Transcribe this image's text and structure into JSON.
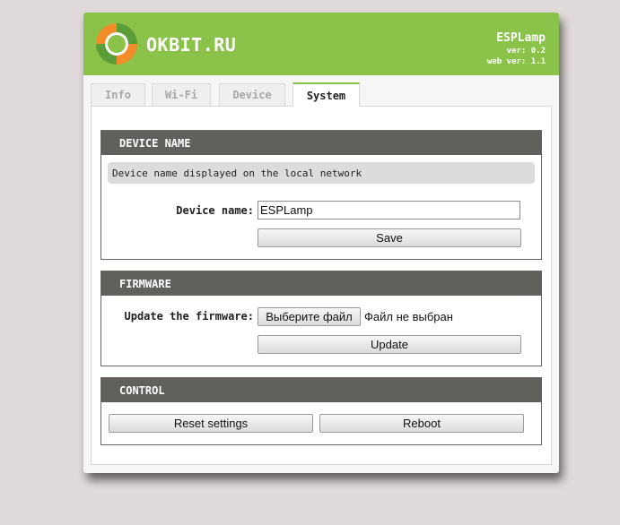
{
  "header": {
    "brand": "OKBIT.RU",
    "app_name": "ESPLamp",
    "version": "ver: 0.2",
    "web_version": "web ver: 1.1"
  },
  "tabs": [
    {
      "label": "Info",
      "active": false
    },
    {
      "label": "Wi-Fi",
      "active": false
    },
    {
      "label": "Device",
      "active": false
    },
    {
      "label": "System",
      "active": true
    }
  ],
  "device_name": {
    "title": "DEVICE NAME",
    "hint": "Device name displayed on the local network",
    "field_label": "Device name:",
    "field_value": "ESPLamp",
    "save_label": "Save"
  },
  "firmware": {
    "title": "FIRMWARE",
    "field_label": "Update the firmware:",
    "choose_file_label": "Выберите файл",
    "file_status": "Файл не выбран",
    "update_label": "Update"
  },
  "control": {
    "title": "CONTROL",
    "reset_label": "Reset settings",
    "reboot_label": "Reboot"
  },
  "colors": {
    "header_green": "#8bc34a",
    "section_header": "#62605c",
    "background": "#e0dada",
    "logo_orange": "#f28c28"
  }
}
